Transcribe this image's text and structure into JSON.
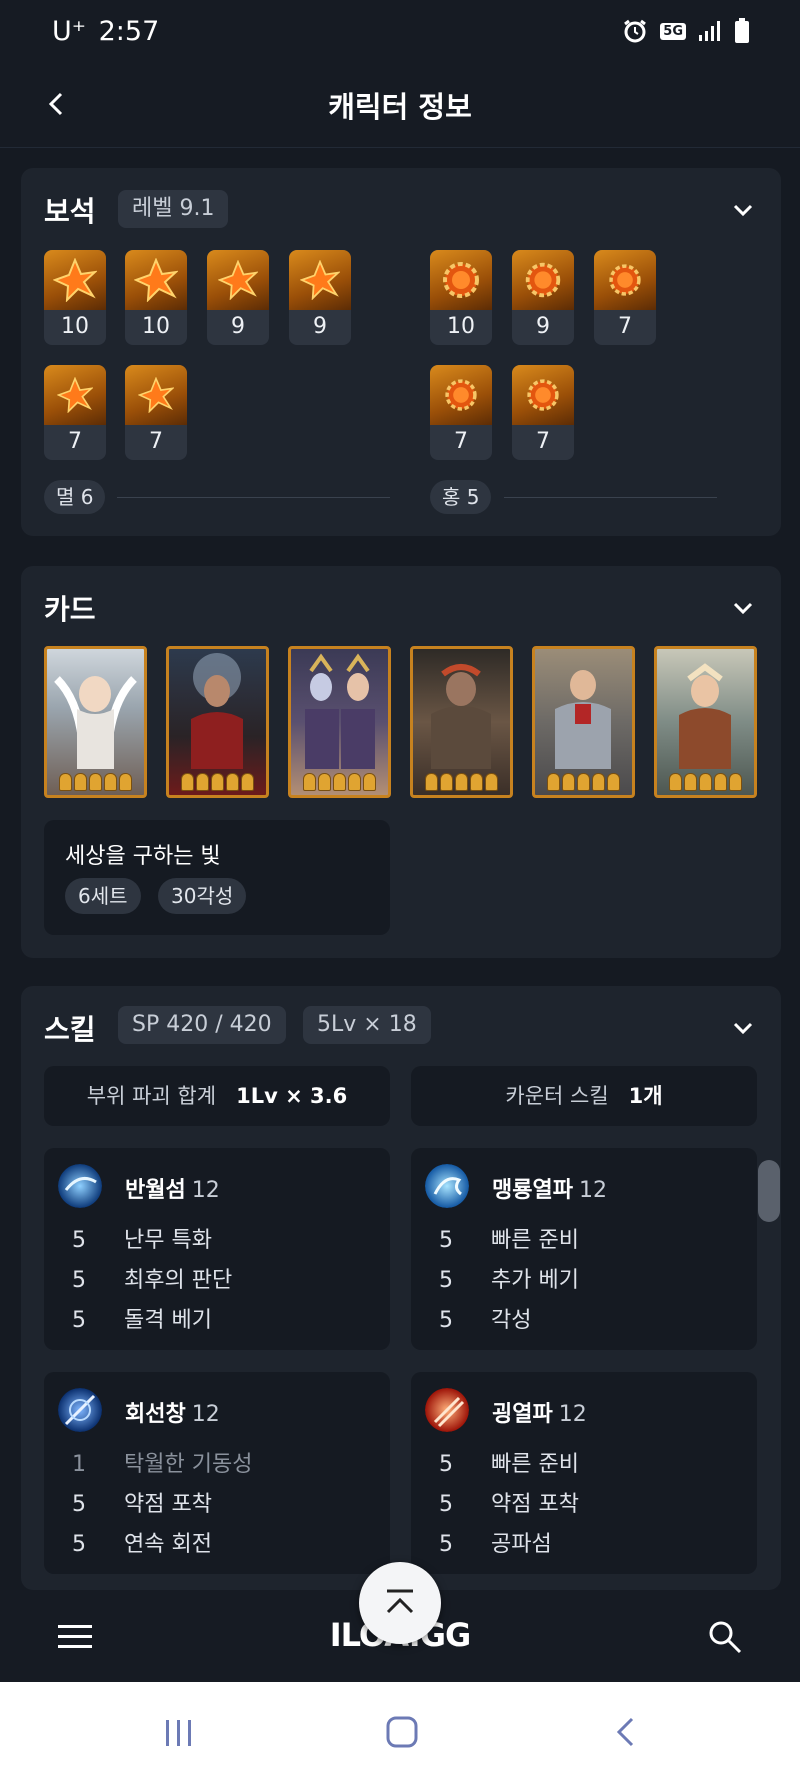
{
  "status_bar": {
    "carrier": "U⁺",
    "time": "2:57",
    "network": "5G"
  },
  "header": {
    "title": "캐릭터 정보"
  },
  "gems": {
    "title": "보석",
    "level_badge": "레벨 9.1",
    "left_levels": [
      "10",
      "10",
      "9",
      "9",
      "7",
      "7"
    ],
    "right_levels": [
      "10",
      "9",
      "7",
      "7",
      "7"
    ],
    "left_summary": "멸 6",
    "right_summary": "홍 5"
  },
  "cards": {
    "title": "카드",
    "count": 6,
    "awakening_per_card": 5,
    "set_name": "세상을 구하는 빛",
    "set_tags": [
      "6세트",
      "30각성"
    ]
  },
  "skills": {
    "title": "스킬",
    "sp_badge": "SP 420 / 420",
    "lv_badge": "5Lv × 18",
    "part_break_label": "부위 파괴 합계",
    "part_break_value": "1Lv × 3.6",
    "counter_label": "카운터 스킬",
    "counter_value": "1개",
    "list": [
      {
        "name": "반월섬",
        "level": "12",
        "tripods": [
          {
            "lv": "5",
            "name": "난무 특화"
          },
          {
            "lv": "5",
            "name": "최후의 판단"
          },
          {
            "lv": "5",
            "name": "돌격 베기"
          }
        ]
      },
      {
        "name": "맹룡열파",
        "level": "12",
        "tripods": [
          {
            "lv": "5",
            "name": "빠른 준비"
          },
          {
            "lv": "5",
            "name": "추가 베기"
          },
          {
            "lv": "5",
            "name": "각성"
          }
        ]
      },
      {
        "name": "회선창",
        "level": "12",
        "tripods": [
          {
            "lv": "1",
            "name": "탁월한 기동성"
          },
          {
            "lv": "5",
            "name": "약점 포착"
          },
          {
            "lv": "5",
            "name": "연속 회전"
          }
        ]
      },
      {
        "name": "굉열파",
        "level": "12",
        "tripods": [
          {
            "lv": "5",
            "name": "빠른 준비"
          },
          {
            "lv": "5",
            "name": "약점 포착"
          },
          {
            "lv": "5",
            "name": "공파섬"
          }
        ]
      }
    ]
  },
  "bottom_bar": {
    "logo": "ILOA.GG"
  },
  "colors": {
    "background": "#151a22",
    "card": "#1e242d",
    "gem_orange": "#d98a1c",
    "card_border": "#c7821f",
    "dim_tripod": "#8a919c"
  }
}
